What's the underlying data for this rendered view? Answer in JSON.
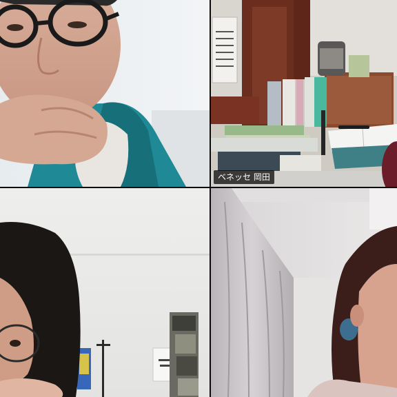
{
  "app": {
    "view": "gallery"
  },
  "participants": [
    {
      "name": "",
      "visible_label": false
    },
    {
      "name": "ベネッセ 岡田",
      "visible_label": true
    },
    {
      "name": "",
      "visible_label": false
    },
    {
      "name": "",
      "visible_label": false
    }
  ],
  "colors": {
    "background": "#0b0b0b",
    "label_bg": "#000000",
    "label_text": "#ffffff"
  },
  "icons": [
    "video-tile-1",
    "video-tile-2",
    "video-tile-3",
    "video-tile-4"
  ]
}
